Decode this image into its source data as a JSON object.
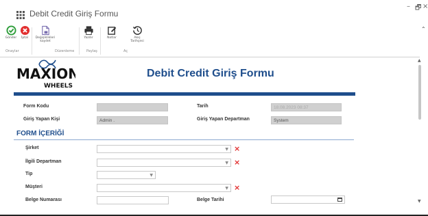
{
  "window": {
    "title": "Debit Credit Giriş Formu",
    "controls": {
      "minimize": "–",
      "restore": "🗗",
      "close": "×"
    }
  },
  "ribbon": {
    "buttons": [
      {
        "label": "Gönder",
        "icon": "check-circle-icon",
        "color": "#2e9d3a"
      },
      {
        "label": "İptal",
        "icon": "cancel-circle-icon",
        "color": "#e23030"
      },
      {
        "label": "Değişiklikleri kaydet",
        "icon": "save-document-icon",
        "color": "#7a6fb0"
      },
      {
        "label": "Yazdır",
        "icon": "printer-icon",
        "color": "#333333"
      },
      {
        "label": "Notlar",
        "icon": "notes-edit-icon",
        "color": "#333333"
      },
      {
        "label": "Akış Tarihçesi",
        "icon": "history-icon",
        "color": "#333333"
      }
    ],
    "groups": [
      "Onaylar",
      "Düzenleme",
      "Paylaş",
      "Aç"
    ]
  },
  "header": {
    "logo_text_main": "MAXION",
    "logo_text_sub": "WHEELS",
    "form_title": "Debit Credit Giriş Formu",
    "accent_color": "#1f4e8c"
  },
  "info": {
    "form_kodu_label": "Form Kodu",
    "form_kodu_value": "",
    "tarih_label": "Tarih",
    "tarih_value": "18.08.2023 08:37",
    "giris_yapan_label": "Giriş Yapan Kişi",
    "giris_yapan_value": "Admin .",
    "departman_label": "Giriş Yapan Departman",
    "departman_value": "System"
  },
  "section": {
    "title": "FORM İÇERİĞİ",
    "fields": {
      "sirket_label": "Şirket",
      "ilgili_departman_label": "İlgili Departman",
      "tip_label": "Tip",
      "musteri_label": "Müşteri",
      "belge_numarasi_label": "Belge Numarası",
      "belge_tarihi_label": "Belge Tarihi"
    }
  }
}
